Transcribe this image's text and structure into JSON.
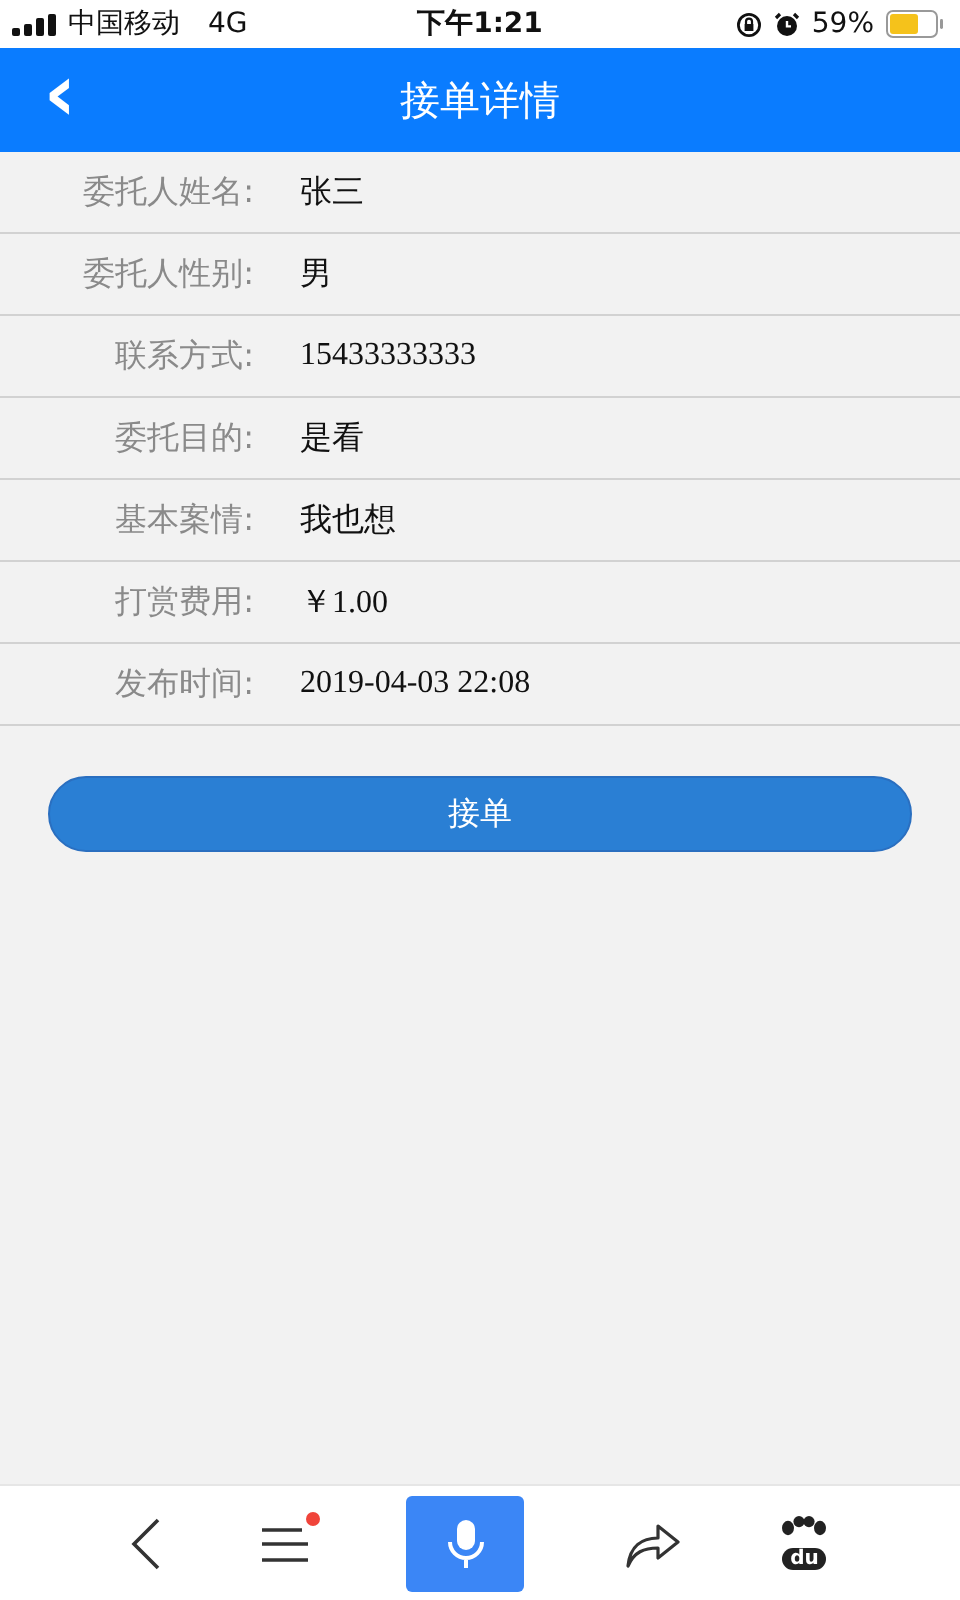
{
  "status_bar": {
    "carrier": "中国移动",
    "network": "4G",
    "time": "下午1:21",
    "battery": "59%"
  },
  "header": {
    "back": "‹",
    "title": "接单详情"
  },
  "fields": [
    {
      "label": "委托人姓名:",
      "value": "张三"
    },
    {
      "label": "委托人性别:",
      "value": "男"
    },
    {
      "label": "联系方式:",
      "value": "15433333333"
    },
    {
      "label": "委托目的:",
      "value": "是看"
    },
    {
      "label": "基本案情:",
      "value": "我也想"
    },
    {
      "label": "打赏费用:",
      "value": "￥1.00"
    },
    {
      "label": "发布时间:",
      "value": "2019-04-03 22:08"
    }
  ],
  "accept_button": "接单",
  "toolbar": {
    "menu_badge": true,
    "logo_text": "du"
  }
}
